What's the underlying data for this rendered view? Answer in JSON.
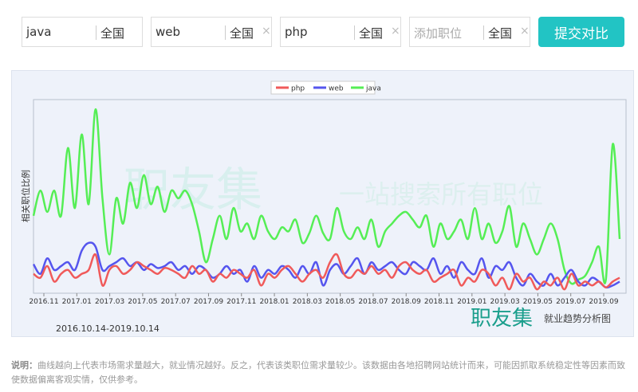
{
  "search": {
    "fields": [
      {
        "keyword": "java",
        "placeholder": "",
        "city": "全国",
        "removable": false
      },
      {
        "keyword": "web",
        "placeholder": "",
        "city": "全国",
        "removable": true
      },
      {
        "keyword": "php",
        "placeholder": "",
        "city": "全国",
        "removable": true
      },
      {
        "keyword": "",
        "placeholder": "添加职位",
        "city": "全国",
        "removable": true
      }
    ],
    "remove_glyph": "×",
    "submit_label": "提交对比"
  },
  "watermark": {
    "brand": "职友集",
    "slogan": "一站搜索所有职位"
  },
  "footer_brand": {
    "brand": "职友集",
    "subtitle": "就业趋势分析图"
  },
  "date_range": "2016.10.14-2019.10.14",
  "note": {
    "label": "说明：",
    "text": "曲线越向上代表市场需求量越大，就业情况越好。反之，代表该类职位需求量较少。该数据由各地招聘网站统计而来，可能因抓取系统稳定性等因素而致使数据偏离客观实情，仅供参考。"
  },
  "chart_data": {
    "type": "line",
    "title": "",
    "xlabel": "",
    "ylabel": "相关职位比例",
    "ylim": [
      0,
      100
    ],
    "x_range": [
      "2016.10.14",
      "2019.10.14"
    ],
    "x_ticks": [
      "2016.11",
      "2017.01",
      "2017.03",
      "2017.05",
      "2017.07",
      "2017.09",
      "2017.11",
      "2018.01",
      "2018.03",
      "2018.05",
      "2018.07",
      "2018.09",
      "2018.11",
      "2019.01",
      "2019.03",
      "2019.05",
      "2019.07",
      "2019.09"
    ],
    "legend": {
      "position": "top-center",
      "entries": [
        "php",
        "web",
        "java"
      ]
    },
    "grid": false,
    "series": [
      {
        "name": "php",
        "color": "#f05a5a",
        "values": [
          10,
          8,
          14,
          6,
          10,
          12,
          8,
          10,
          12,
          20,
          4,
          12,
          14,
          10,
          12,
          16,
          14,
          12,
          10,
          13,
          12,
          10,
          8,
          14,
          10,
          12,
          6,
          10,
          8,
          12,
          10,
          8,
          12,
          4,
          10,
          8,
          12,
          14,
          10,
          6,
          10,
          12,
          8,
          16,
          20,
          10,
          8,
          12,
          10,
          14,
          10,
          12,
          8,
          14,
          16,
          12,
          10,
          12,
          6,
          8,
          10,
          12,
          4,
          8,
          6,
          12,
          10,
          4,
          8,
          2,
          10,
          6,
          8,
          2,
          6,
          4,
          8,
          2,
          10,
          4,
          6,
          4,
          6,
          3,
          6,
          8
        ]
      },
      {
        "name": "web",
        "color": "#5555ee",
        "values": [
          15,
          10,
          18,
          12,
          14,
          16,
          12,
          22,
          26,
          24,
          12,
          14,
          16,
          18,
          14,
          16,
          12,
          15,
          13,
          14,
          16,
          12,
          14,
          10,
          14,
          12,
          8,
          10,
          14,
          10,
          12,
          6,
          14,
          8,
          12,
          10,
          14,
          12,
          8,
          14,
          10,
          16,
          4,
          12,
          15,
          10,
          14,
          18,
          10,
          16,
          12,
          14,
          16,
          12,
          10,
          16,
          14,
          12,
          18,
          10,
          14,
          8,
          16,
          12,
          10,
          18,
          8,
          14,
          12,
          16,
          8,
          4,
          10,
          6,
          4,
          10,
          4,
          8,
          12,
          6,
          4,
          8,
          6,
          3,
          4,
          6
        ]
      },
      {
        "name": "java",
        "color": "#55ee55",
        "values": [
          40,
          53,
          42,
          53,
          40,
          75,
          44,
          82,
          46,
          95,
          49,
          20,
          49,
          36,
          57,
          44,
          61,
          46,
          55,
          42,
          53,
          49,
          53,
          46,
          32,
          16,
          28,
          40,
          28,
          44,
          32,
          36,
          28,
          40,
          32,
          28,
          34,
          32,
          38,
          26,
          31,
          40,
          31,
          28,
          44,
          32,
          28,
          34,
          28,
          38,
          24,
          32,
          36,
          40,
          42,
          38,
          34,
          40,
          24,
          36,
          28,
          32,
          38,
          28,
          44,
          28,
          36,
          26,
          32,
          45,
          24,
          36,
          28,
          20,
          28,
          36,
          28,
          12,
          5,
          7,
          9,
          16,
          24,
          7,
          77,
          28
        ]
      }
    ]
  }
}
